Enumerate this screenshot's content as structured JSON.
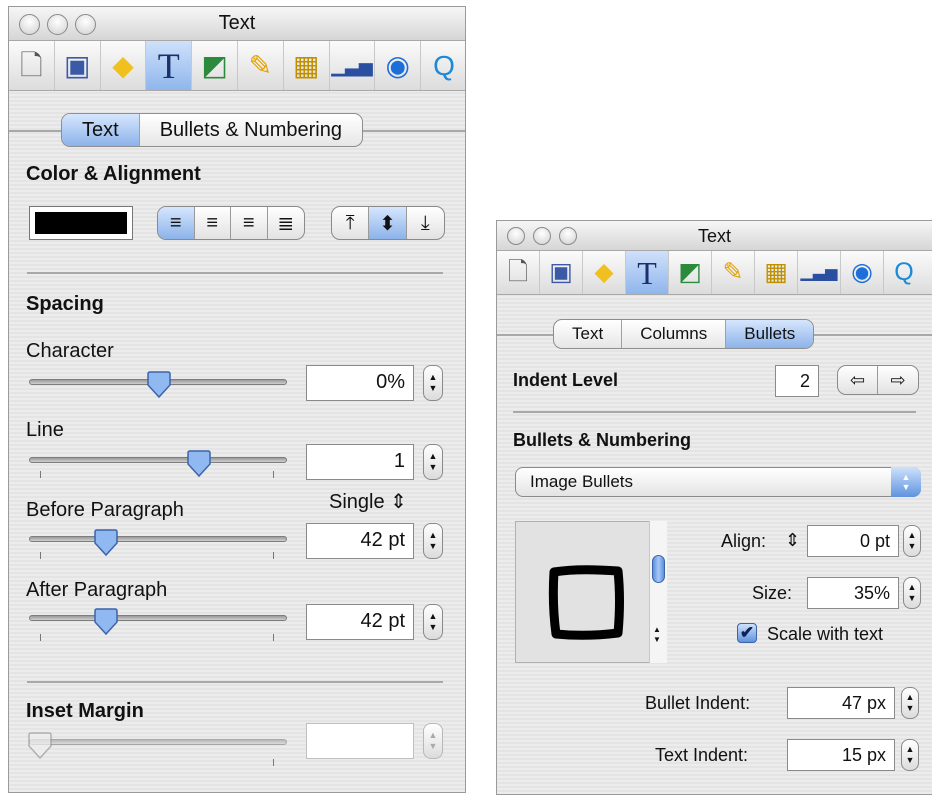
{
  "left_panel": {
    "title": "Text",
    "toolbar": [
      {
        "name": "document-icon",
        "glyph": "🗋"
      },
      {
        "name": "slide-icon",
        "glyph": "▭"
      },
      {
        "name": "transition-icon",
        "glyph": "◆"
      },
      {
        "name": "text-icon",
        "glyph": "T"
      },
      {
        "name": "shapes-icon",
        "glyph": "◪"
      },
      {
        "name": "ruler-icon",
        "glyph": "✎"
      },
      {
        "name": "table-icon",
        "glyph": "▦"
      },
      {
        "name": "chart-icon",
        "glyph": "▁▃▅"
      },
      {
        "name": "build-icon",
        "glyph": "➲"
      },
      {
        "name": "quicktime-icon",
        "glyph": "Q"
      }
    ],
    "tabs": [
      "Text",
      "Bullets & Numbering"
    ],
    "selected_tab": "Text",
    "color_alignment": {
      "heading": "Color & Alignment",
      "color": "#000000",
      "horizontal_align": [
        "≡",
        "≡",
        "≡",
        "≣"
      ],
      "horizontal_selected": 0,
      "vertical_align": [
        "⤒",
        "⬍",
        "⤓"
      ],
      "vertical_selected": 1
    },
    "spacing": {
      "heading": "Spacing",
      "character": {
        "label": "Character",
        "value": "0%",
        "level": 0.5
      },
      "line": {
        "label": "Line",
        "value": "1",
        "level": 0.66,
        "mode": "Single ⇕"
      },
      "before_paragraph": {
        "label": "Before Paragraph",
        "value": "42 pt",
        "level": 0.31
      },
      "after_paragraph": {
        "label": "After Paragraph",
        "value": "42 pt",
        "level": 0.31
      }
    },
    "inset_margin": {
      "heading": "Inset Margin",
      "value": "",
      "level": 0.0
    }
  },
  "right_panel": {
    "title": "Text",
    "tabs": [
      "Text",
      "Columns",
      "Bullets"
    ],
    "selected_tab": "Bullets",
    "indent_level": {
      "label": "Indent Level",
      "value": "2",
      "arrows": [
        "⇦",
        "⇨"
      ]
    },
    "bullets_numbering": {
      "heading": "Bullets & Numbering",
      "type": "Image Bullets",
      "align": {
        "label": "Align:",
        "icon": "⇕",
        "value": "0 pt"
      },
      "size": {
        "label": "Size:",
        "value": "35%"
      },
      "scale_with_text": {
        "label": "Scale with text",
        "checked": true
      },
      "bullet_indent": {
        "label": "Bullet Indent:",
        "value": "47 px"
      },
      "text_indent": {
        "label": "Text Indent:",
        "value": "15 px"
      }
    }
  },
  "colors": {
    "accent": "#8cb3ea",
    "panel": "#e8e8e8"
  }
}
